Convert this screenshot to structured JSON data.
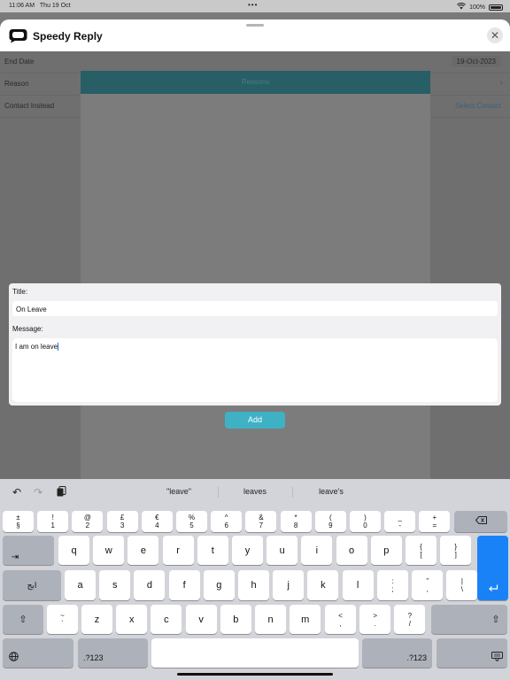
{
  "status": {
    "time": "11:06 AM",
    "date": "Thu 19 Oct",
    "dots": "•••",
    "battery": "100%"
  },
  "app": {
    "title": "Speedy Reply",
    "close_label": "✕"
  },
  "rows": [
    {
      "label": "End Date",
      "value": "19-Oct-2023"
    },
    {
      "label": "Reason",
      "value": ""
    },
    {
      "label": "Contact Instead",
      "value": "Select Contact"
    }
  ],
  "reasons": {
    "header": "Reasons"
  },
  "card": {
    "title_label": "Title:",
    "title_value": "On Leave",
    "message_label": "Message:",
    "message_value": "I am on leave"
  },
  "add_label": "Add",
  "keyboard": {
    "suggestions": [
      "\"leave\"",
      "leaves",
      "leave's"
    ],
    "row1": [
      {
        "top": "±",
        "bottom": "§"
      },
      {
        "top": "!",
        "bottom": "1"
      },
      {
        "top": "@",
        "bottom": "2"
      },
      {
        "top": "£",
        "bottom": "3"
      },
      {
        "top": "€",
        "bottom": "4"
      },
      {
        "top": "%",
        "bottom": "5"
      },
      {
        "top": "^",
        "bottom": "6"
      },
      {
        "top": "&",
        "bottom": "7"
      },
      {
        "top": "*",
        "bottom": "8"
      },
      {
        "top": "(",
        "bottom": "9"
      },
      {
        "top": ")",
        "bottom": "0"
      },
      {
        "top": "_",
        "bottom": "-"
      },
      {
        "top": "+",
        "bottom": "="
      }
    ],
    "row2": [
      "q",
      "w",
      "e",
      "r",
      "t",
      "y",
      "u",
      "i",
      "o",
      "p"
    ],
    "row2_extra": [
      {
        "top": "{",
        "bottom": "["
      },
      {
        "top": "}",
        "bottom": "]"
      }
    ],
    "row3": [
      "a",
      "s",
      "d",
      "f",
      "g",
      "h",
      "j",
      "k",
      "l"
    ],
    "row3_extra": [
      {
        "top": ":",
        "bottom": ";"
      },
      {
        "top": "”",
        "bottom": ","
      },
      {
        "top": "|",
        "bottom": "\\"
      }
    ],
    "row4_extra_left": {
      "top": "~",
      "bottom": "`"
    },
    "row4": [
      "z",
      "x",
      "c",
      "v",
      "b",
      "n",
      "m"
    ],
    "row4_extra": [
      {
        "top": "<",
        "bottom": ","
      },
      {
        "top": ">",
        "bottom": "."
      },
      {
        "top": "?",
        "bottom": "/"
      }
    ],
    "lang_label": "ابج",
    "num_label": ".?123"
  }
}
